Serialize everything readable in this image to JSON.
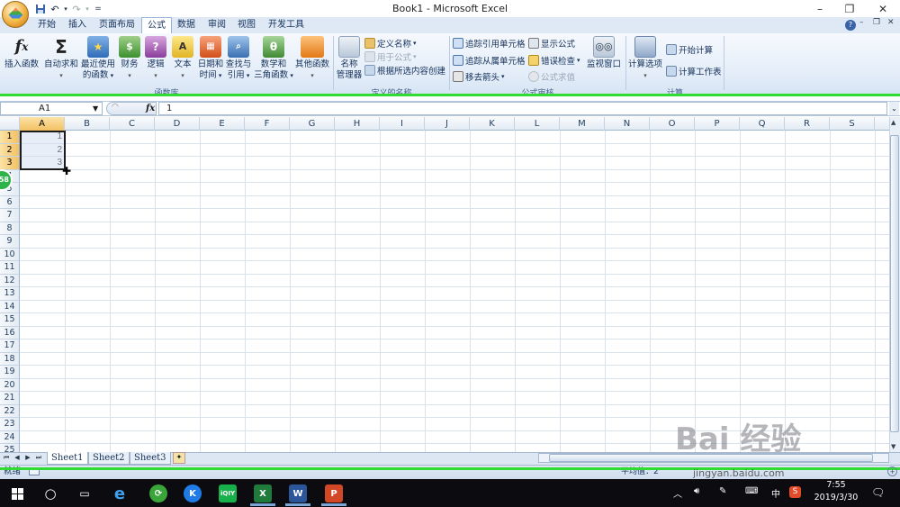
{
  "app": {
    "title": "Book1 - Microsoft Excel",
    "window_controls": [
      "–",
      "❐",
      "✕"
    ]
  },
  "qat": {
    "save": "save-icon",
    "undo": "undo-icon",
    "redo": "redo-icon",
    "custom": "="
  },
  "tabs": [
    {
      "label": "开始",
      "active": false
    },
    {
      "label": "插入",
      "active": false
    },
    {
      "label": "页面布局",
      "active": false
    },
    {
      "label": "公式",
      "active": true
    },
    {
      "label": "数据",
      "active": false
    },
    {
      "label": "审阅",
      "active": false
    },
    {
      "label": "视图",
      "active": false
    },
    {
      "label": "开发工具",
      "active": false
    }
  ],
  "ribbon": {
    "function_library": {
      "label": "函数库",
      "insert_function": "插入函数",
      "autosum": "自动求和",
      "recent_1": "最近使用",
      "recent_2": "的函数",
      "financial": "财务",
      "logical": "逻辑",
      "text": "文本",
      "datetime_1": "日期和",
      "datetime_2": "时间",
      "lookup_1": "查找与",
      "lookup_2": "引用",
      "math_1": "数学和",
      "math_2": "三角函数",
      "more": "其他函数"
    },
    "defined_names": {
      "label": "定义的名称",
      "name_manager_1": "名称",
      "name_manager_2": "管理器",
      "define_name": "定义名称",
      "use_in_formula": "用于公式",
      "create_from_selection": "根据所选内容创建"
    },
    "formula_auditing": {
      "label": "公式审核",
      "trace_precedents": "追踪引用单元格",
      "trace_dependents": "追踪从属单元格",
      "remove_arrows": "移去箭头",
      "show_formulas": "显示公式",
      "error_checking": "错误检查",
      "evaluate_formula": "公式求值",
      "watch_window": "监视窗口"
    },
    "calculation": {
      "label": "计算",
      "calc_options": "计算选项",
      "calc_now": "开始计算",
      "calc_sheet": "计算工作表"
    }
  },
  "formula_bar": {
    "name_box": "A1",
    "fx": "fx",
    "value": "1"
  },
  "grid": {
    "columns": [
      "A",
      "B",
      "C",
      "D",
      "E",
      "F",
      "G",
      "H",
      "I",
      "J",
      "K",
      "L",
      "M",
      "N",
      "O",
      "P",
      "Q",
      "R",
      "S"
    ],
    "rows": [
      "1",
      "2",
      "3",
      "4",
      "5",
      "6",
      "7",
      "8",
      "9",
      "10",
      "11",
      "12",
      "13",
      "14",
      "15",
      "16",
      "17",
      "18",
      "19",
      "20",
      "21",
      "22",
      "23",
      "24",
      "25"
    ],
    "cells": [
      {
        "ref": "A1",
        "value": "1"
      },
      {
        "ref": "A2",
        "value": "2"
      },
      {
        "ref": "A3",
        "value": "3"
      }
    ],
    "selection": "A1:A3"
  },
  "overlay_badge": "58",
  "sheets": [
    {
      "label": "Sheet1",
      "active": true
    },
    {
      "label": "Sheet2",
      "active": false
    },
    {
      "label": "Sheet3",
      "active": false
    }
  ],
  "status": {
    "ready": "就绪",
    "right": "平均值：2"
  },
  "taskbar": {
    "apps": [
      "windows-icon",
      "cortana-icon",
      "task-view-icon",
      "ie-icon",
      "360-icon",
      "kugou-icon",
      "iqiyi-icon",
      "excel-icon",
      "word-icon",
      "powerpoint-icon"
    ],
    "tray_lang": "中",
    "time": "7:55",
    "date": "2019/3/30"
  },
  "watermark": {
    "brand": "Bai 经验",
    "url": "jingyan.baidu.com"
  },
  "colors": {
    "ribbon_bg": "#e2ecf8",
    "selection_header": "#f3c063",
    "highlight_green": "#2fdc2f",
    "taskbar": "#0c0c10"
  }
}
